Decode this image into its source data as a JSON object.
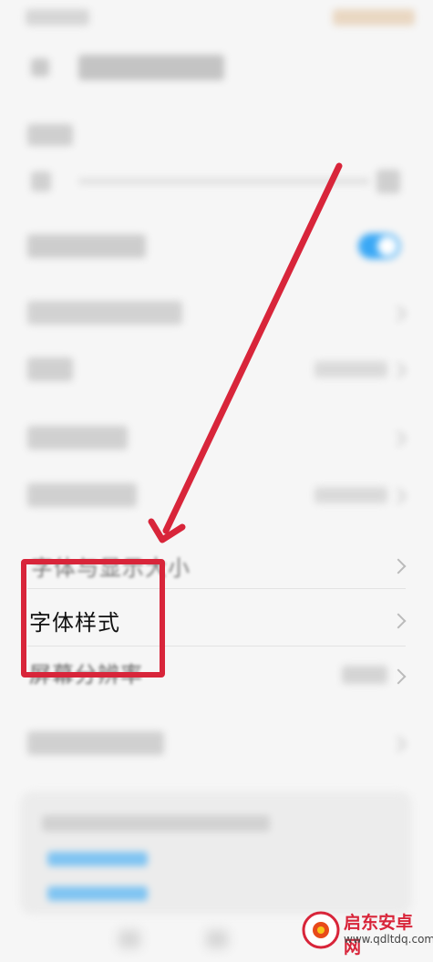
{
  "settings": {
    "items": [
      {
        "id": "font-display-size",
        "label": "字体与显示大小"
      },
      {
        "id": "font-style",
        "label": "字体样式"
      },
      {
        "id": "screen-resolution",
        "label": "屏幕分辨率"
      }
    ]
  },
  "colors": {
    "annotation": "#d8253a",
    "toggle": "#3aa8f5",
    "link": "#7fc4f2"
  },
  "watermark": {
    "brand": "启东安卓网",
    "url": "www.qdltdq.com"
  }
}
